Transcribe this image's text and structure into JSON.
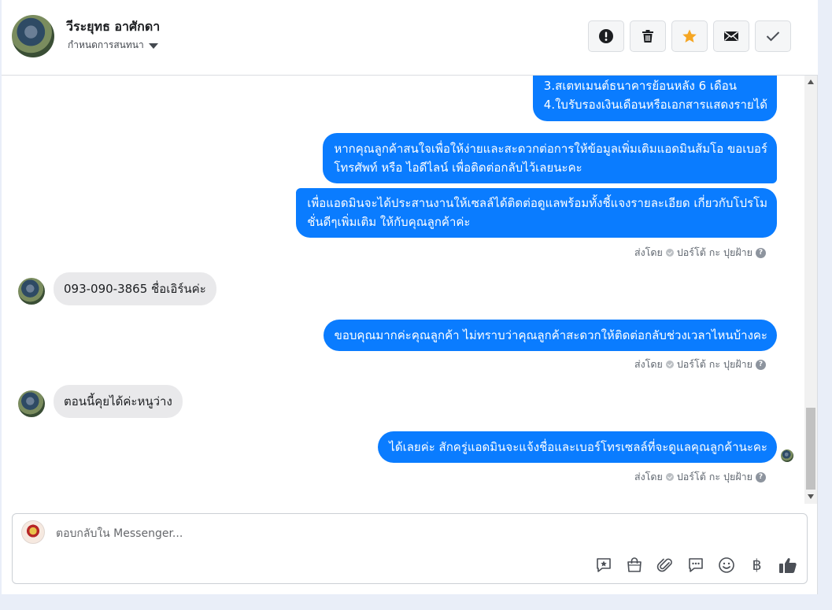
{
  "header": {
    "contact_name": "วีระยุทธ อาศักดา",
    "assign_label": "กำหนดการสนทนา",
    "actions": [
      {
        "name": "mark-spam",
        "icon": "alert-icon"
      },
      {
        "name": "delete",
        "icon": "trash-icon"
      },
      {
        "name": "star",
        "icon": "star-icon"
      },
      {
        "name": "mark-unread",
        "icon": "envelope-icon"
      },
      {
        "name": "mark-done",
        "icon": "check-icon"
      }
    ],
    "star_color": "#f5a623"
  },
  "messages": {
    "out_1_line_1": "3.สเตทเมนต์ธนาคารย้อนหลัง 6 เดือน",
    "out_1_line_2": "4.ใบรับรองเงินเดือนหรือเอกสารแสดงรายได้",
    "out_2_line_1": "หากคุณลูกค้าสนใจเพื่อให้ง่ายและสะดวกต่อการให้ข้อมูลเพิ่มเติมแอดมินส้มโอ ขอเบอร์",
    "out_2_line_2": "โทรศัพท์ หรือ ไอดีไลน์ เพื่อติดต่อกลับไว้เลยนะคะ",
    "out_3_line_1": "เพื่อแอดมินจะได้ประสานงานให้เซลล์ได้ติดต่อดูแลพร้อมทั้งชี้แจงรายละเอียด เกี่ยวกับโปรโม",
    "out_3_line_2": "ชั่นดีๆเพิ่มเติม ให้กับคุณลูกค้าค่ะ",
    "in_1": "093-090-3865 ชื่อเอิร์นค่ะ",
    "out_4": "ขอบคุณมากค่ะคุณลูกค้า ไม่ทราบว่าคุณลูกค้าสะดวกให้ติดต่อกลับช่วงเวลาไหนบ้างคะ",
    "in_2": "ตอนนี้คุยได้ค่ะหนูว่าง",
    "out_5": "ได้เลยค่ะ สักครู่แอดมินจะแจ้งชื่อและเบอร์โทรเซลล์ที่จะดูแลคุณลูกค้านะคะ",
    "sent_by_prefix": "ส่งโดย",
    "sent_by_name": "ปอร์โต้ กะ ปุยฝ้าย",
    "bubble_color": "#0a7cff"
  },
  "composer": {
    "placeholder": "ตอบกลับใน Messenger...",
    "tools": [
      "saved-reply-icon",
      "shop-bag-icon",
      "attach-icon",
      "chat-bubble-icon",
      "emoji-icon",
      "baht-icon",
      "like-icon"
    ],
    "baht_symbol": "฿"
  }
}
